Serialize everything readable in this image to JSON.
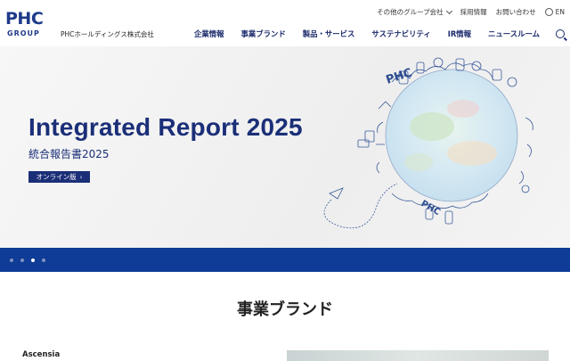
{
  "header": {
    "logo_main": "PHC",
    "logo_sub": "GROUP",
    "company_name": "PHCホールディングス株式会社",
    "utility": {
      "group_companies": "その他のグループ会社",
      "careers": "採用情報",
      "contact": "お問い合わせ",
      "language": "EN"
    },
    "nav": [
      {
        "label": "企業情報"
      },
      {
        "label": "事業ブランド"
      },
      {
        "label": "製品・サービス"
      },
      {
        "label": "サステナビリティ"
      },
      {
        "label": "IR情報"
      },
      {
        "label": "ニュースルーム"
      }
    ]
  },
  "hero": {
    "title": "Integrated Report 2025",
    "subtitle": "統合報告書2025",
    "button_label": "オンライン版",
    "globe_text": "PHC",
    "slide_count": 4,
    "active_slide": 3
  },
  "section": {
    "title": "事業ブランド",
    "first_brand": "Ascensia"
  },
  "colors": {
    "brand_navy": "#1b2f78",
    "slider_bar": "#0f3c96"
  },
  "icons": [
    "chevron-down-icon",
    "globe-icon",
    "search-icon",
    "arrow-right-icon"
  ]
}
